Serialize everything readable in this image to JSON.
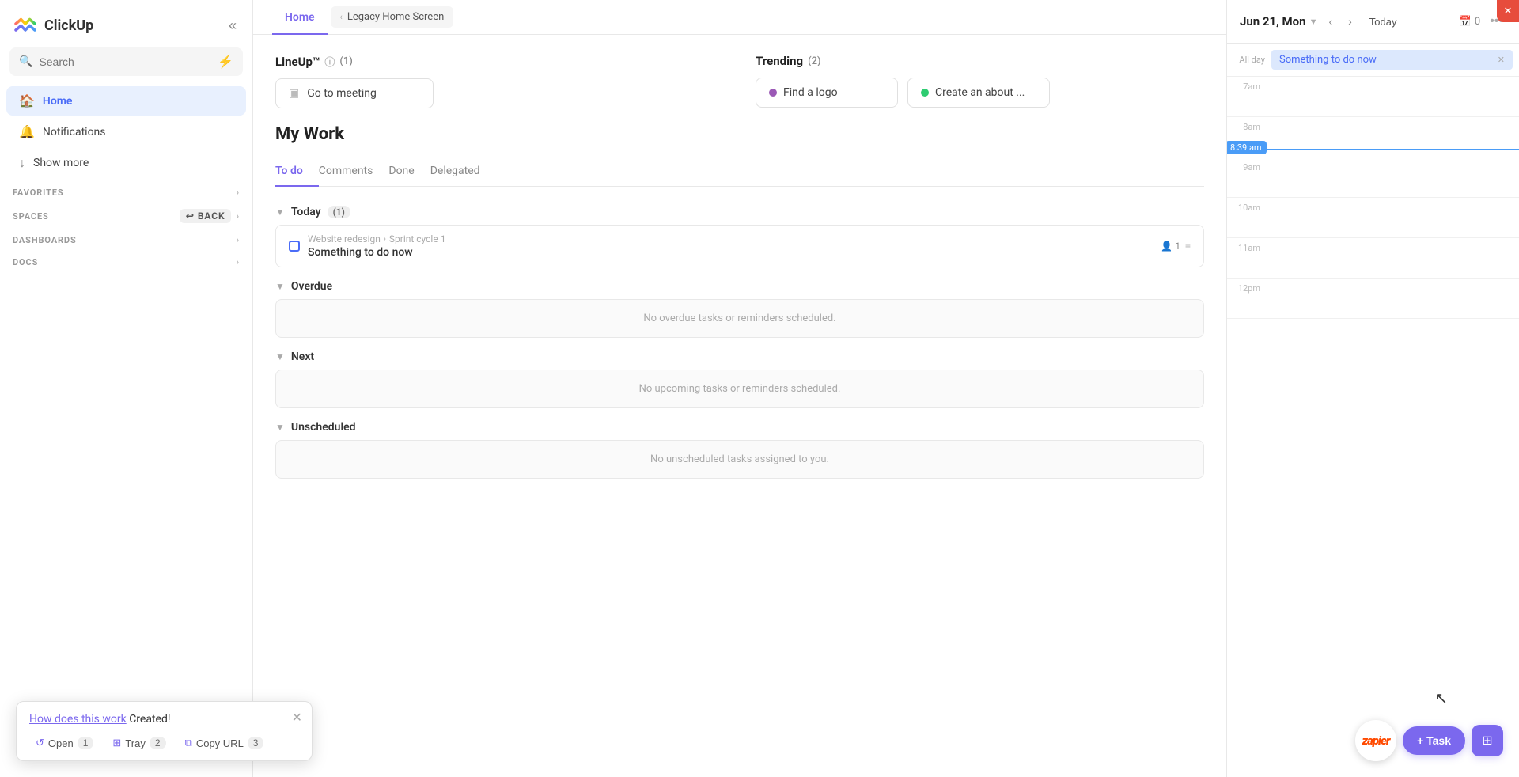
{
  "app": {
    "name": "ClickUp",
    "logo_text": "ClickUp"
  },
  "sidebar": {
    "search_placeholder": "Search",
    "nav_items": [
      {
        "id": "home",
        "label": "Home",
        "active": true
      },
      {
        "id": "notifications",
        "label": "Notifications",
        "active": false
      },
      {
        "id": "show-more",
        "label": "Show more",
        "active": false
      }
    ],
    "sections": [
      {
        "id": "favorites",
        "label": "FAVORITES"
      },
      {
        "id": "spaces",
        "label": "SPACES"
      },
      {
        "id": "dashboards",
        "label": "DASHBOARDS"
      },
      {
        "id": "docs",
        "label": "DOCS"
      }
    ],
    "back_label": "Back"
  },
  "tabs": {
    "home_label": "Home",
    "legacy_label": "Legacy Home Screen"
  },
  "lineup": {
    "title": "LineUp™",
    "info": "ⓘ",
    "count": "(1)",
    "task": "Go to meeting"
  },
  "trending": {
    "title": "Trending",
    "count": "(2)",
    "items": [
      {
        "label": "Find a logo",
        "dot_color": "purple"
      },
      {
        "label": "Create an about ...",
        "dot_color": "green"
      }
    ]
  },
  "my_work": {
    "title": "My Work",
    "tabs": [
      {
        "id": "todo",
        "label": "To do",
        "active": true
      },
      {
        "id": "comments",
        "label": "Comments",
        "active": false
      },
      {
        "id": "done",
        "label": "Done",
        "active": false
      },
      {
        "id": "delegated",
        "label": "Delegated",
        "active": false
      }
    ]
  },
  "task_sections": {
    "today": {
      "label": "Today",
      "count": "1",
      "tasks": [
        {
          "breadcrumb_1": "Website redesign",
          "breadcrumb_2": "Sprint cycle 1",
          "name": "Something to do now",
          "assignee_count": "1"
        }
      ]
    },
    "overdue": {
      "label": "Overdue",
      "empty_text": "No overdue tasks or reminders scheduled."
    },
    "next": {
      "label": "Next",
      "empty_text": "No upcoming tasks or reminders scheduled."
    },
    "unscheduled": {
      "label": "Unscheduled",
      "empty_text": "No unscheduled tasks assigned to you."
    }
  },
  "calendar": {
    "date_label": "Jun 21, Mon",
    "today_label": "Today",
    "event_count": "0",
    "all_day_event": "Something to do now",
    "time_slots": [
      {
        "label": "7am"
      },
      {
        "label": "8am"
      },
      {
        "label": "9am"
      },
      {
        "label": "10am"
      },
      {
        "label": "11am"
      },
      {
        "label": "12pm"
      }
    ],
    "current_time": "8:39 am"
  },
  "toast": {
    "text_1": "How does this work",
    "text_2": " Created!",
    "actions": [
      {
        "id": "open",
        "icon": "↺",
        "label": "Open",
        "count": "1"
      },
      {
        "id": "tray",
        "icon": "⊞",
        "label": "Tray",
        "count": "2"
      },
      {
        "id": "copy-url",
        "icon": "⧉",
        "label": "Copy URL",
        "count": "3"
      }
    ]
  },
  "fab": {
    "add_task_label": "+ Task",
    "zapier_label": "zapier"
  }
}
